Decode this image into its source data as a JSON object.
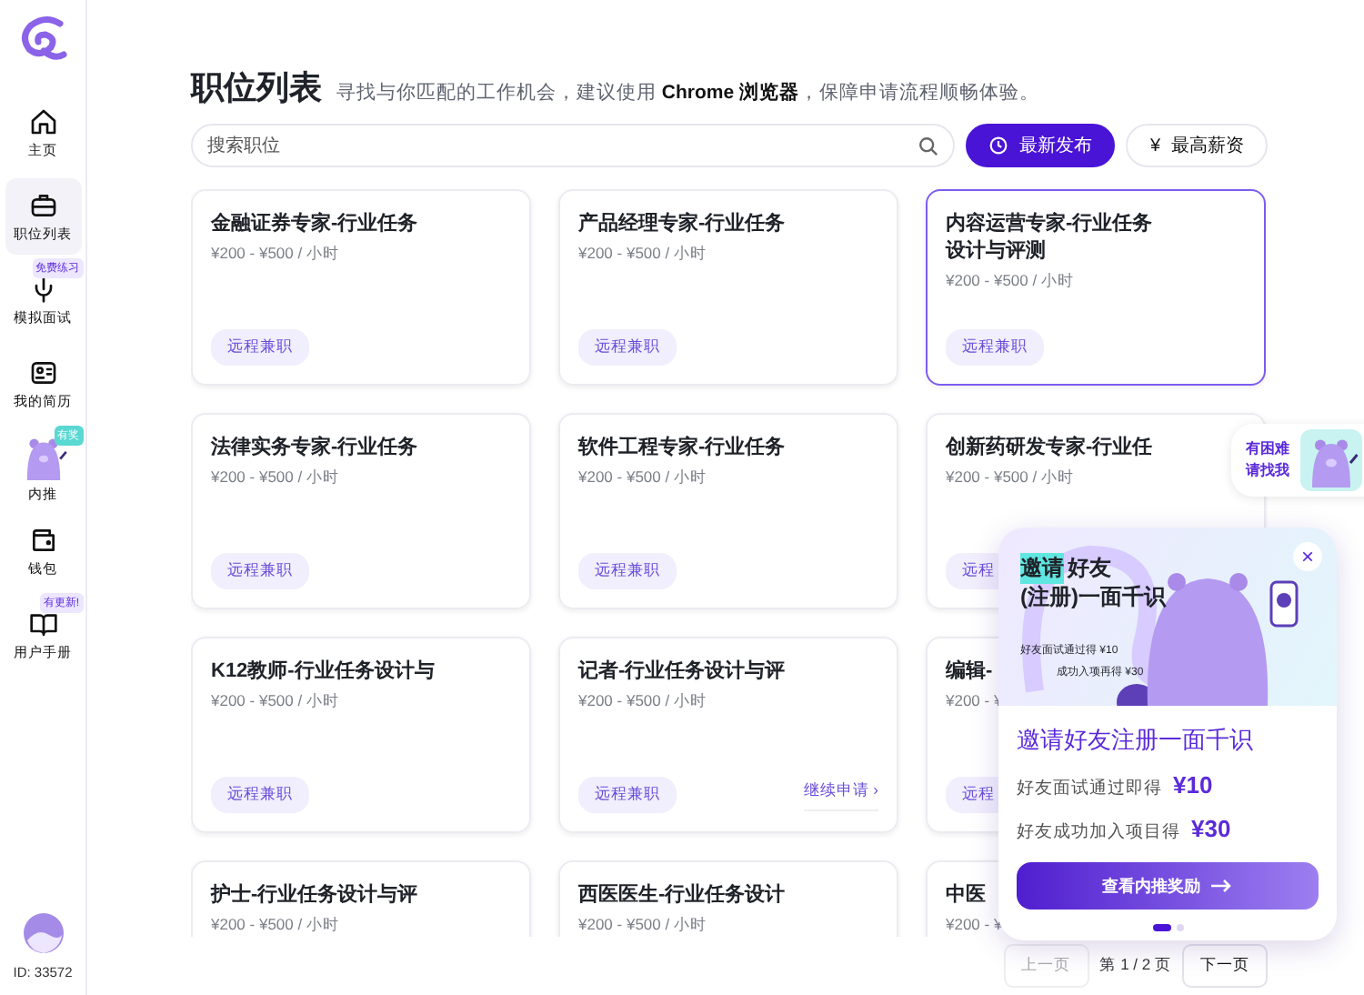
{
  "sidebar": {
    "items": [
      {
        "label": "主页",
        "selected": false
      },
      {
        "label": "职位列表",
        "selected": true
      },
      {
        "label": "模拟面试",
        "selected": false,
        "badge": "免费练习"
      },
      {
        "label": "我的简历",
        "selected": false
      },
      {
        "label": "内推",
        "selected": false,
        "badge": "有奖"
      },
      {
        "label": "钱包",
        "selected": false
      },
      {
        "label": "用户手册",
        "selected": false,
        "badge": "有更新!"
      }
    ],
    "user_id": "ID: 33572"
  },
  "header": {
    "title": "职位列表",
    "subtitle": "寻找与你匹配的工作机会，建议使用 **Chrome 浏览器**，保障申请流程顺畅体验。"
  },
  "search": {
    "placeholder": "搜索职位"
  },
  "sort_buttons": [
    {
      "label": "最新发布",
      "selected": true
    },
    {
      "label": "最高薪资",
      "symbol": "¥",
      "selected": false
    }
  ],
  "jobs": [
    {
      "title": "金融证券专家-行业任务",
      "pay": "¥200 - ¥500 / 小时",
      "tag": "远程兼职",
      "selected": false
    },
    {
      "title": "产品经理专家-行业任务",
      "pay": "¥200 - ¥500 / 小时",
      "tag": "远程兼职",
      "selected": false
    },
    {
      "title": "内容运营专家-行业任务设计与评测",
      "pay": "¥200 - ¥500 / 小时",
      "tag": "远程兼职",
      "selected": true
    },
    {
      "title": "法律实务专家-行业任务",
      "pay": "¥200 - ¥500 / 小时",
      "tag": "远程兼职",
      "selected": false
    },
    {
      "title": "软件工程专家-行业任务",
      "pay": "¥200 - ¥500 / 小时",
      "tag": "远程兼职",
      "selected": false
    },
    {
      "title": "创新药研发专家-行业任",
      "pay": "¥200 - ¥500 / 小时",
      "tag": "远程",
      "selected": false
    },
    {
      "title": "K12教师-行业任务设计与",
      "pay": "¥200 - ¥500 / 小时",
      "tag": "远程兼职",
      "selected": false
    },
    {
      "title": "记者-行业任务设计与评",
      "pay": "¥200 - ¥500 / 小时",
      "tag": "远程兼职",
      "action": "继续申请 ›",
      "selected": false
    },
    {
      "title": "编辑-",
      "pay": "¥200 - ¥",
      "tag": "远程",
      "selected": false
    },
    {
      "title": "护士-行业任务设计与评",
      "pay": "¥200 - ¥500 / 小时",
      "selected": false
    },
    {
      "title": "西医医生-行业任务设计",
      "pay": "¥200 - ¥500 / 小时",
      "selected": false
    },
    {
      "title": "中医",
      "pay": "¥200 - ¥",
      "selected": false
    }
  ],
  "pagination": {
    "prev": {
      "label": "上一页",
      "disabled": true
    },
    "status": "第 1 / 2 页",
    "next": {
      "label": "下一页",
      "disabled": false
    }
  },
  "help_widget": {
    "text": "有困难请找我"
  },
  "promo": {
    "banner": {
      "highlight": "邀请",
      "rest": "好友",
      "line2": "(注册)一面千识",
      "note_1": "好友面试通过得 ¥10",
      "note_2": "成功入项再得 ¥30"
    },
    "close": "×",
    "title": "邀请好友注册一面千识",
    "rewards": [
      {
        "label": "好友面试通过即得",
        "amount": "¥10"
      },
      {
        "label": "好友成功加入项目得",
        "amount": "¥30"
      }
    ],
    "button": "查看内推奖励",
    "slides": [
      {
        "selected": true
      },
      {
        "selected": false
      }
    ]
  }
}
